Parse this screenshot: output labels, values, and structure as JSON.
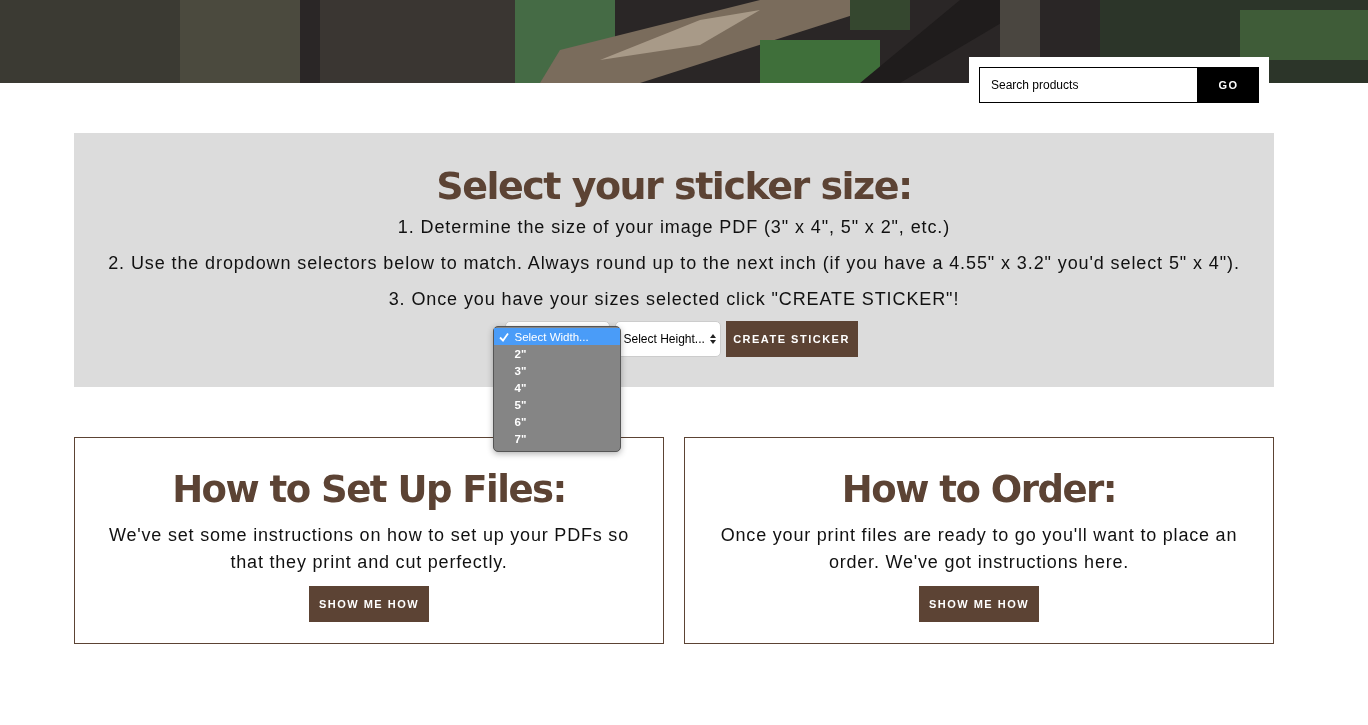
{
  "search": {
    "placeholder": "Search products",
    "button": "GO"
  },
  "sizer": {
    "title": "Select your sticker size:",
    "steps": [
      "1. Determine the size of your image PDF (3\" x 4\", 5\" x 2\", etc.)",
      "2. Use the dropdown selectors below to match. Always round up to the next inch (if you have a 4.55\" x 3.2\" you'd select 5\" x 4\").",
      "3. Once you have your sizes selected click \"CREATE STICKER\"!"
    ],
    "width_options": [
      {
        "label": "Select Width...",
        "selected": true
      },
      {
        "label": "2\"",
        "selected": false
      },
      {
        "label": "3\"",
        "selected": false
      },
      {
        "label": "4\"",
        "selected": false
      },
      {
        "label": "5\"",
        "selected": false
      },
      {
        "label": "6\"",
        "selected": false
      },
      {
        "label": "7\"",
        "selected": false
      }
    ],
    "height_select": "Select Height...",
    "button": "CREATE STICKER"
  },
  "cards": [
    {
      "title": "How to Set Up Files:",
      "text": "We've set some instructions on how to set up your PDFs so that they print and cut perfectly.",
      "button": "SHOW ME HOW"
    },
    {
      "title": "How to Order:",
      "text": "Once your print files are ready to go you'll want to place an order. We've got instructions here.",
      "button": "SHOW ME HOW"
    }
  ]
}
